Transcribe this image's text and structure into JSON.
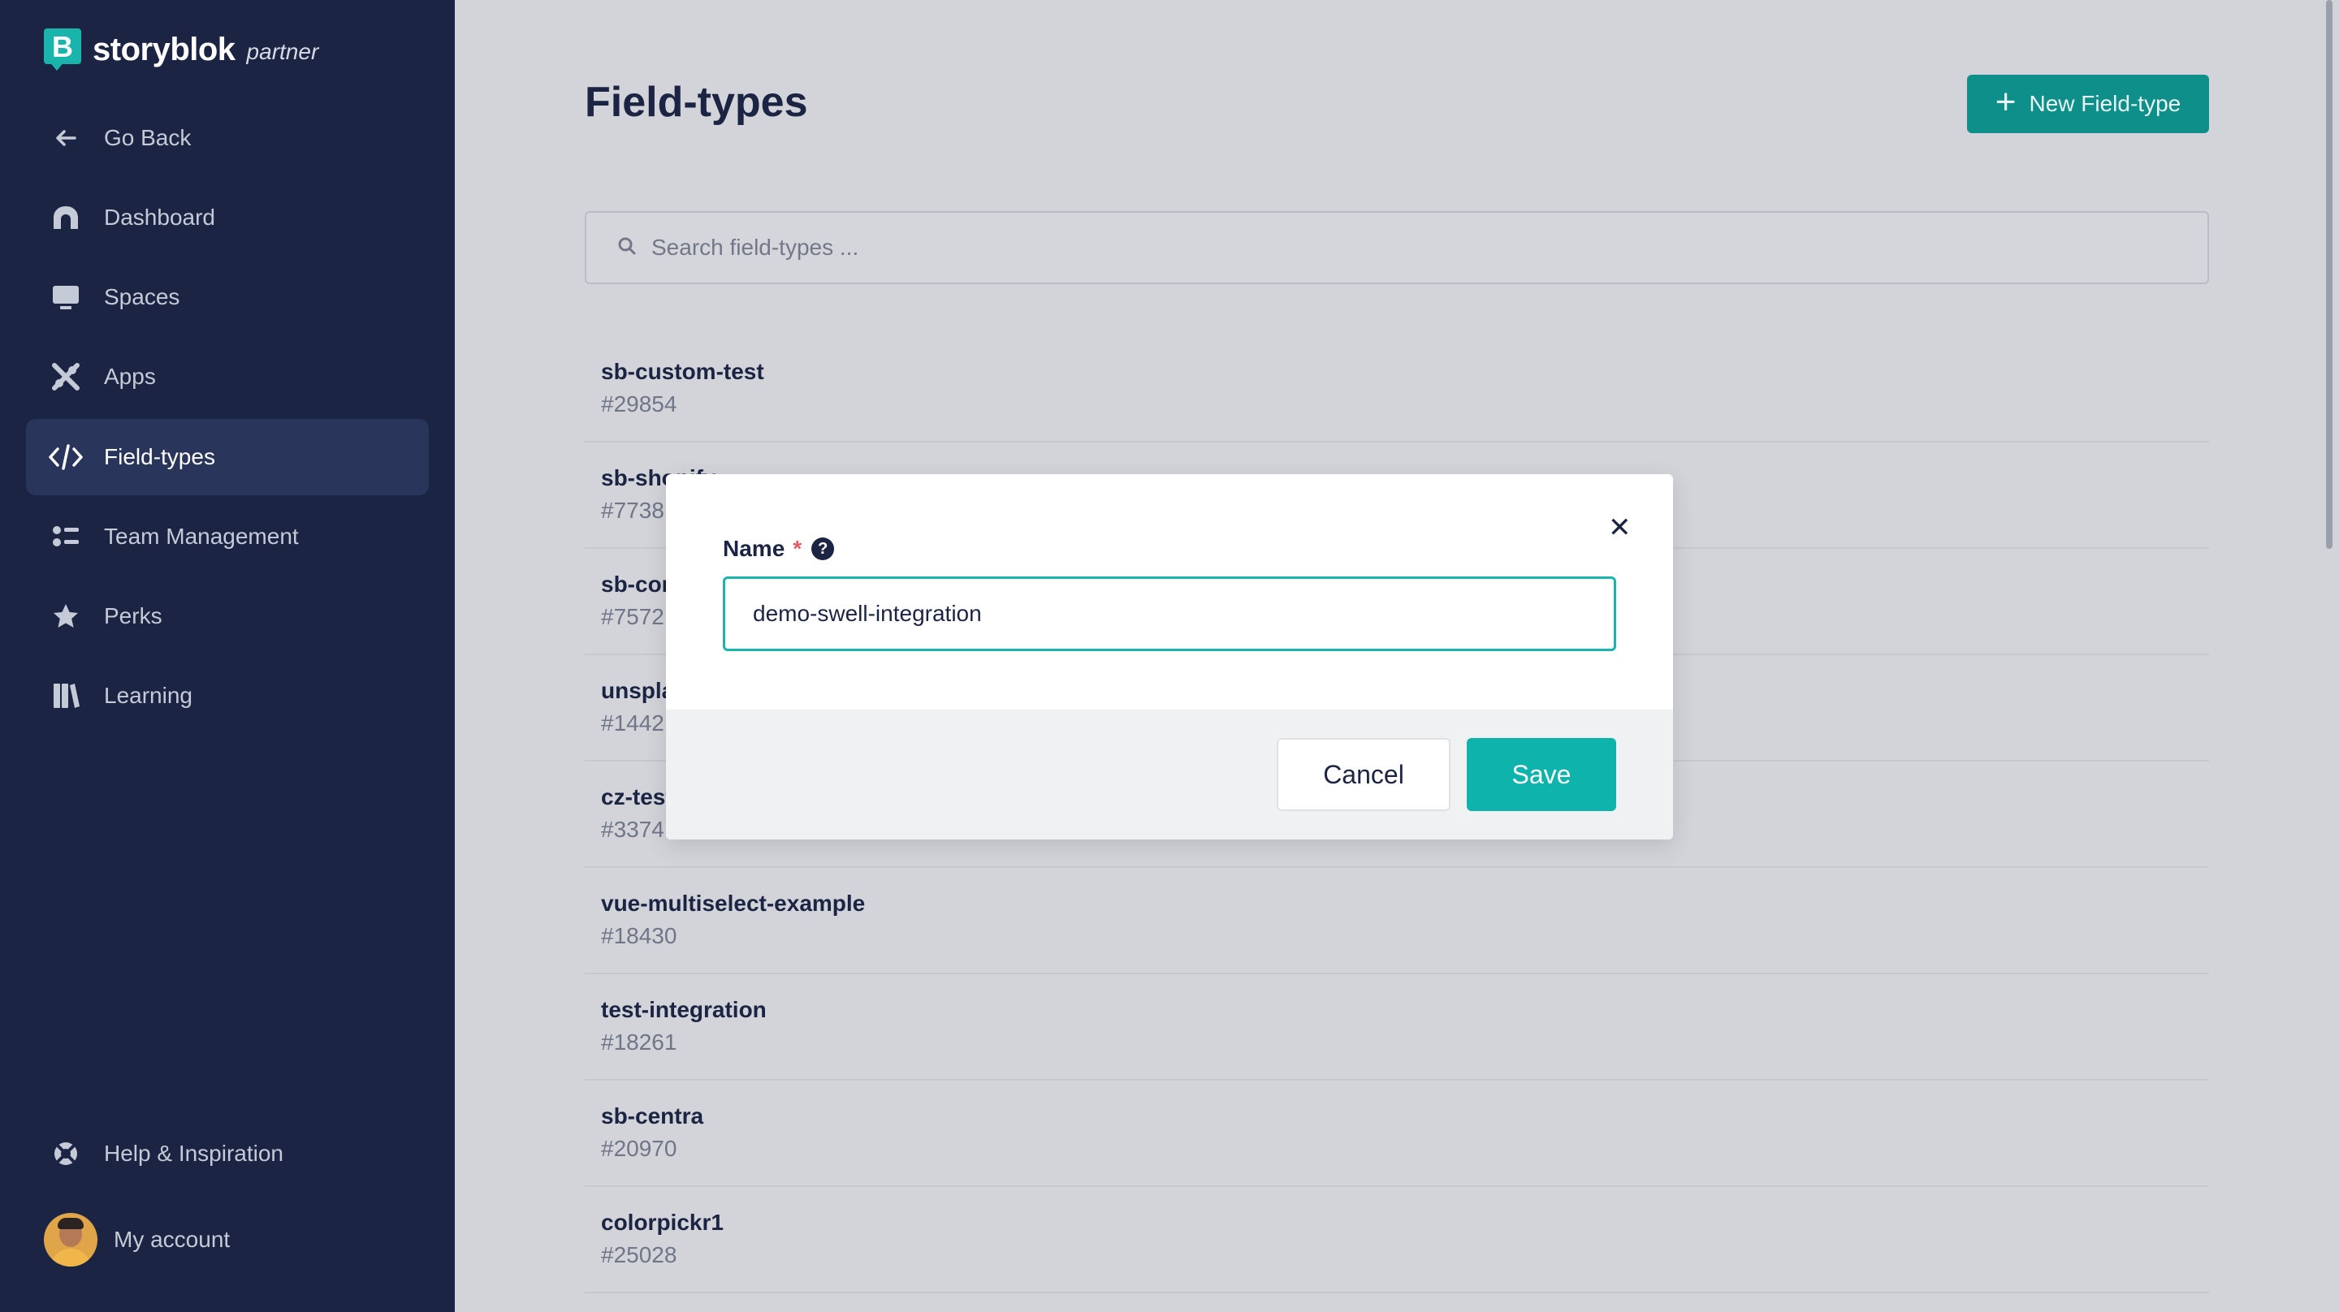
{
  "brand": {
    "name": "storyblok",
    "sub": "partner",
    "logo_letter": "B"
  },
  "sidebar": {
    "items": [
      {
        "label": "Go Back",
        "icon": "arrow-left-icon"
      },
      {
        "label": "Dashboard",
        "icon": "dashboard-icon"
      },
      {
        "label": "Spaces",
        "icon": "monitor-icon"
      },
      {
        "label": "Apps",
        "icon": "apps-icon"
      },
      {
        "label": "Field-types",
        "icon": "code-icon",
        "active": true
      },
      {
        "label": "Team Management",
        "icon": "team-icon"
      },
      {
        "label": "Perks",
        "icon": "star-icon"
      },
      {
        "label": "Learning",
        "icon": "books-icon"
      }
    ],
    "help": {
      "label": "Help & Inspiration",
      "icon": "lifebuoy-icon"
    },
    "account": {
      "label": "My account"
    }
  },
  "header": {
    "title": "Field-types",
    "new_button": {
      "label": "New Field-type",
      "icon": "plus-icon"
    }
  },
  "search": {
    "placeholder": "Search field-types ...",
    "value": ""
  },
  "field_types": [
    {
      "name": "sb-custom-test",
      "id": "#29854"
    },
    {
      "name": "sb-shopify",
      "id": "#7738"
    },
    {
      "name": "sb-commercetools",
      "id": "#7572"
    },
    {
      "name": "unsplash",
      "id": "#1442"
    },
    {
      "name": "cz-test",
      "id": "#3374"
    },
    {
      "name": "vue-multiselect-example",
      "id": "#18430"
    },
    {
      "name": "test-integration",
      "id": "#18261"
    },
    {
      "name": "sb-centra",
      "id": "#20970"
    },
    {
      "name": "colorpickr1",
      "id": "#25028"
    }
  ],
  "modal": {
    "label": "Name",
    "required_marker": "*",
    "input_value": "demo-swell-integration",
    "cancel_label": "Cancel",
    "save_label": "Save",
    "close_glyph": "✕"
  },
  "colors": {
    "sidebar_bg": "#1b2543",
    "accent": "#19b5ac",
    "primary_button": "#0f8f89"
  }
}
